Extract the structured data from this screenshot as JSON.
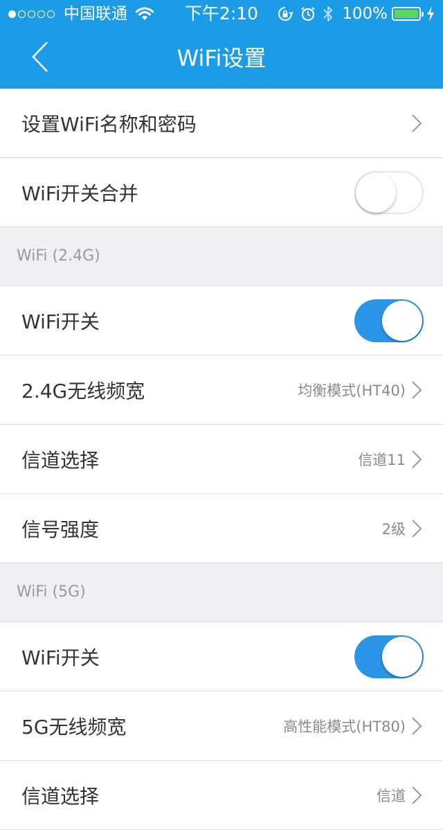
{
  "status_bar": {
    "carrier": "中国联通",
    "time": "下午2:10",
    "battery": "100%",
    "signal_icon": "signal-dots-icon",
    "wifi_icon": "wifi-icon",
    "lock_icon": "orientation-lock-icon",
    "alarm_icon": "alarm-icon",
    "bluetooth_icon": "bluetooth-icon",
    "charging_icon": "charging-bolt-icon"
  },
  "nav": {
    "title": "WiFi设置",
    "back_icon": "chevron-left-icon"
  },
  "colors": {
    "header_bg": "#1c9be6",
    "toggle_on": "#2b95e8",
    "section_bg": "#efeff4",
    "battery_fill": "#5cd65c"
  },
  "rows": {
    "set_name_password": {
      "label": "设置WiFi名称和密码"
    },
    "merge_switch": {
      "label": "WiFi开关合并",
      "on": false
    }
  },
  "section_24g": {
    "header": "WiFi (2.4G)",
    "wifi_switch": {
      "label": "WiFi开关",
      "on": true
    },
    "bandwidth": {
      "label": "2.4G无线频宽",
      "value": "均衡模式(HT40)"
    },
    "channel": {
      "label": "信道选择",
      "value": "信道11"
    },
    "signal": {
      "label": "信号强度",
      "value": "2级"
    }
  },
  "section_5g": {
    "header": "WiFi (5G)",
    "wifi_switch": {
      "label": "WiFi开关",
      "on": true
    },
    "bandwidth": {
      "label": "5G无线频宽",
      "value": "高性能模式(HT80)"
    },
    "channel": {
      "label": "信道选择",
      "value": "信道"
    }
  }
}
